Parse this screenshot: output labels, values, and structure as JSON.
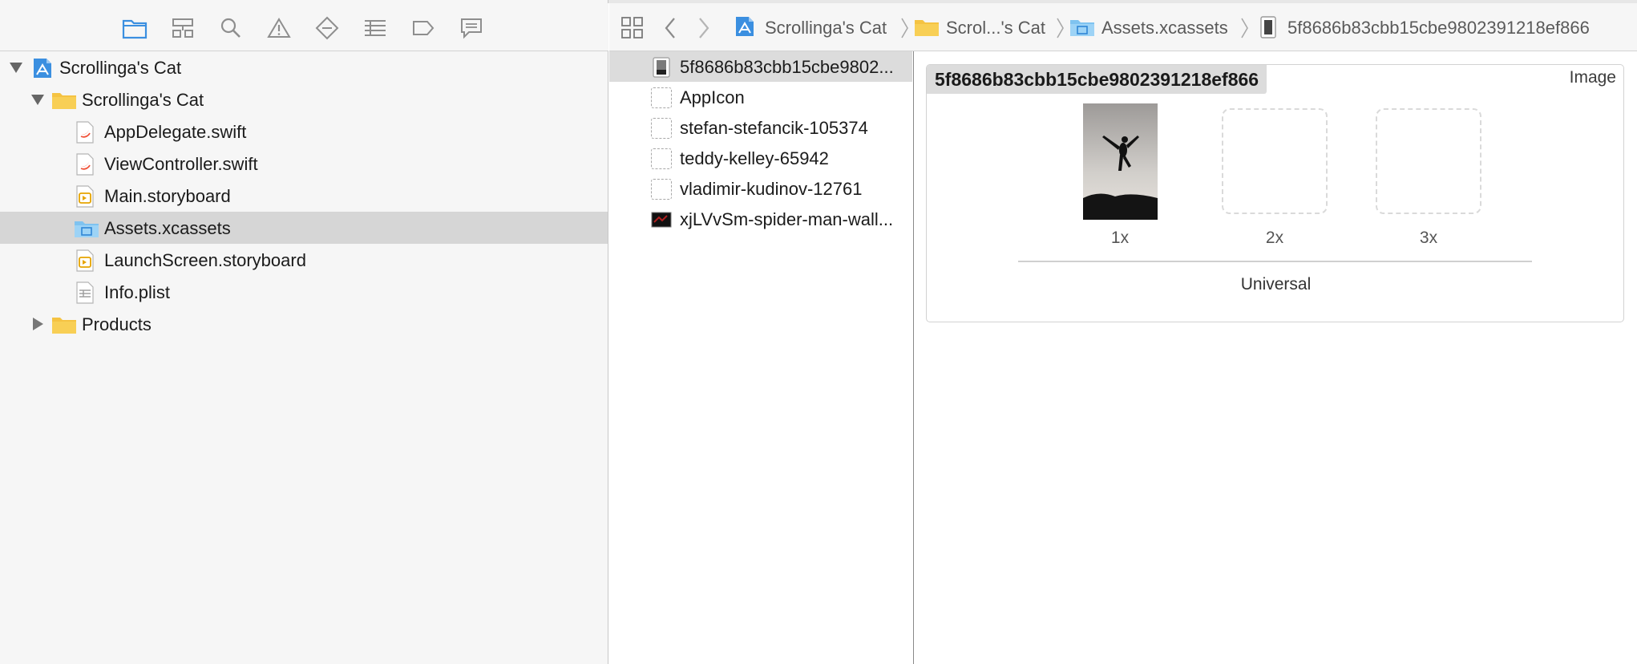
{
  "navigator": {
    "toolbar_icons": [
      "folder-icon",
      "hierarchy-icon",
      "search-icon",
      "warning-icon",
      "test-diamond-icon",
      "debug-list-icon",
      "breakpoint-icon",
      "report-icon"
    ],
    "tree": [
      {
        "label": "Scrollinga's Cat",
        "icon": "project-icon",
        "disclosure": "expanded",
        "level": 0
      },
      {
        "label": "Scrollinga's Cat",
        "icon": "group-folder-icon",
        "disclosure": "expanded",
        "level": 1
      },
      {
        "label": "AppDelegate.swift",
        "icon": "swift-file-icon",
        "level": 2
      },
      {
        "label": "ViewController.swift",
        "icon": "swift-file-icon",
        "level": 2
      },
      {
        "label": "Main.storyboard",
        "icon": "storyboard-file-icon",
        "level": 2
      },
      {
        "label": "Assets.xcassets",
        "icon": "asset-catalog-icon",
        "level": 2,
        "selected": true
      },
      {
        "label": "LaunchScreen.storyboard",
        "icon": "storyboard-file-icon",
        "level": 2
      },
      {
        "label": "Info.plist",
        "icon": "plist-file-icon",
        "level": 2
      },
      {
        "label": "Products",
        "icon": "group-folder-icon",
        "disclosure": "collapsed",
        "level": 1
      }
    ]
  },
  "jumpbar": {
    "crumbs": [
      "Scrollinga's Cat",
      "Scrol...'s Cat",
      "Assets.xcassets",
      "5f8686b83cbb15cbe9802391218ef866"
    ]
  },
  "assets": [
    {
      "label": "5f8686b83cbb15cbe9802...",
      "thumb": "image",
      "selected": true
    },
    {
      "label": "AppIcon",
      "thumb": "empty"
    },
    {
      "label": "stefan-stefancik-105374",
      "thumb": "empty"
    },
    {
      "label": "teddy-kelley-65942",
      "thumb": "empty"
    },
    {
      "label": "vladimir-kudinov-12761",
      "thumb": "empty"
    },
    {
      "label": "xjLVvSm-spider-man-wall...",
      "thumb": "image-dark"
    }
  ],
  "editor": {
    "set_name": "5f8686b83cbb15cbe9802391218ef866",
    "set_type": "Image",
    "slots": [
      {
        "label": "1x",
        "filled": true
      },
      {
        "label": "2x",
        "filled": false
      },
      {
        "label": "3x",
        "filled": false
      }
    ],
    "idiom": "Universal"
  },
  "colors": {
    "selection_gray": "#d6d6d6",
    "folder_yellow": "#f5c342",
    "xcode_blue": "#3b8fe0",
    "icon_gray": "#8e8e8e"
  }
}
